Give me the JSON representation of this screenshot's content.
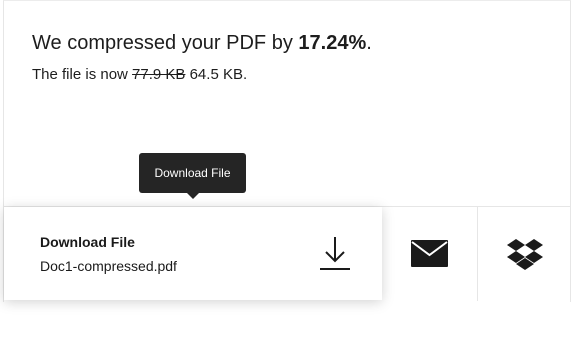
{
  "result": {
    "headline_prefix": "We compressed your PDF by ",
    "headline_percent": "17.24%",
    "headline_suffix": ".",
    "subline_prefix": "The file is now ",
    "original_size": "77.9 KB",
    "new_size": " 64.5 KB",
    "subline_suffix": "."
  },
  "tooltip": {
    "text": "Download File"
  },
  "download": {
    "title": "Download File",
    "filename": "Doc1-compressed.pdf",
    "icon": "download-icon"
  },
  "actions": {
    "email_icon": "envelope-icon",
    "dropbox_icon": "dropbox-icon"
  },
  "colors": {
    "tooltip_bg": "#252525",
    "text": "#1a1a1a",
    "border": "#e6e6e6"
  }
}
